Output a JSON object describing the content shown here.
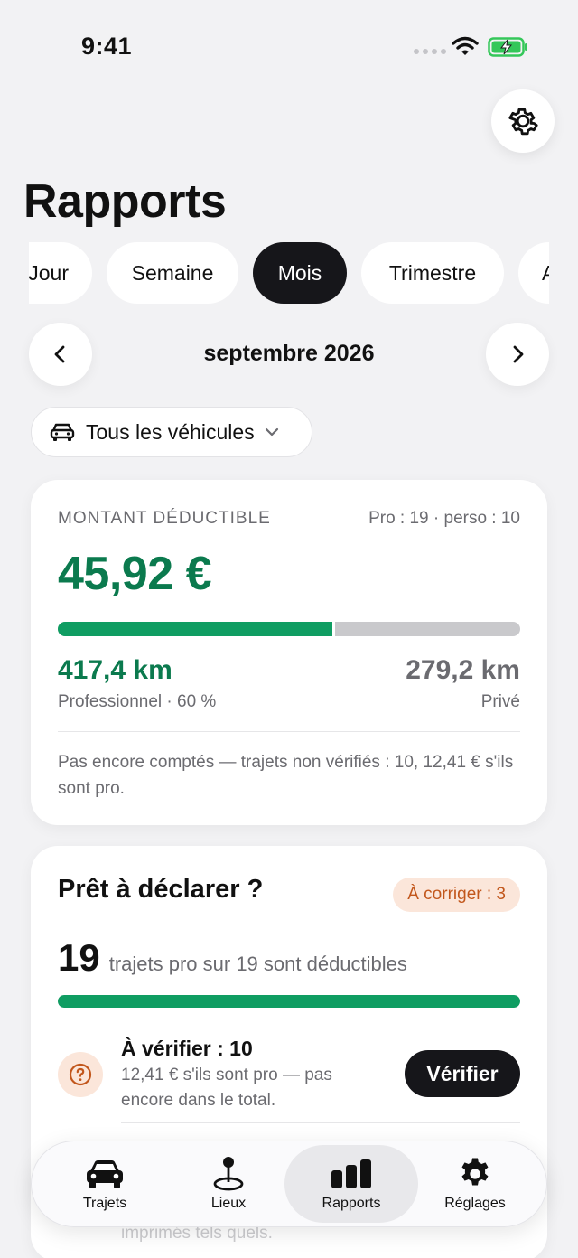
{
  "status": {
    "time": "9:41"
  },
  "header": {
    "title": "Rapports"
  },
  "periods": [
    {
      "label": "Jour",
      "active": false
    },
    {
      "label": "Semaine",
      "active": false
    },
    {
      "label": "Mois",
      "active": true
    },
    {
      "label": "Trimestre",
      "active": false
    },
    {
      "label": "Année",
      "active": false
    }
  ],
  "navigator": {
    "month": "septembre 2026"
  },
  "vehicle_filter": {
    "label": "Tous les véhicules"
  },
  "deductible": {
    "label": "MONTANT DÉDUCTIBLE",
    "split": "Pro : 19 · perso : 10",
    "amount": "45,92 €",
    "pro_share": 0.6,
    "pro_km": "417,4 km",
    "pro_label": "Professionnel · 60 %",
    "private_km": "279,2 km",
    "private_label": "Privé",
    "note": "Pas encore comptés — trajets non vérifiés : 10, 12,41 € s'ils sont pro."
  },
  "declare": {
    "title": "Prêt à déclarer ?",
    "badge": "À corriger : 3",
    "count": "19",
    "count_text": "trajets pro sur 19 sont déductibles",
    "progress": 1.0,
    "verify_title": "À vérifier : 10",
    "verify_desc": "12,41 € s'ils sont pro — pas encore dans le total.",
    "verify_button": "Vérifier",
    "faded_text": "imprimés tels quels."
  },
  "tabbar": {
    "items": [
      {
        "label": "Trajets",
        "icon": "car-icon"
      },
      {
        "label": "Lieux",
        "icon": "map-pin-icon"
      },
      {
        "label": "Rapports",
        "icon": "bar-chart-icon",
        "active": true
      },
      {
        "label": "Réglages",
        "icon": "gear-icon"
      }
    ]
  },
  "colors": {
    "accent": "#0b7a4e",
    "bar_green": "#0f9d62",
    "warning": "#c2571c",
    "warning_bg": "#fbe6da",
    "dark": "#16161a"
  }
}
